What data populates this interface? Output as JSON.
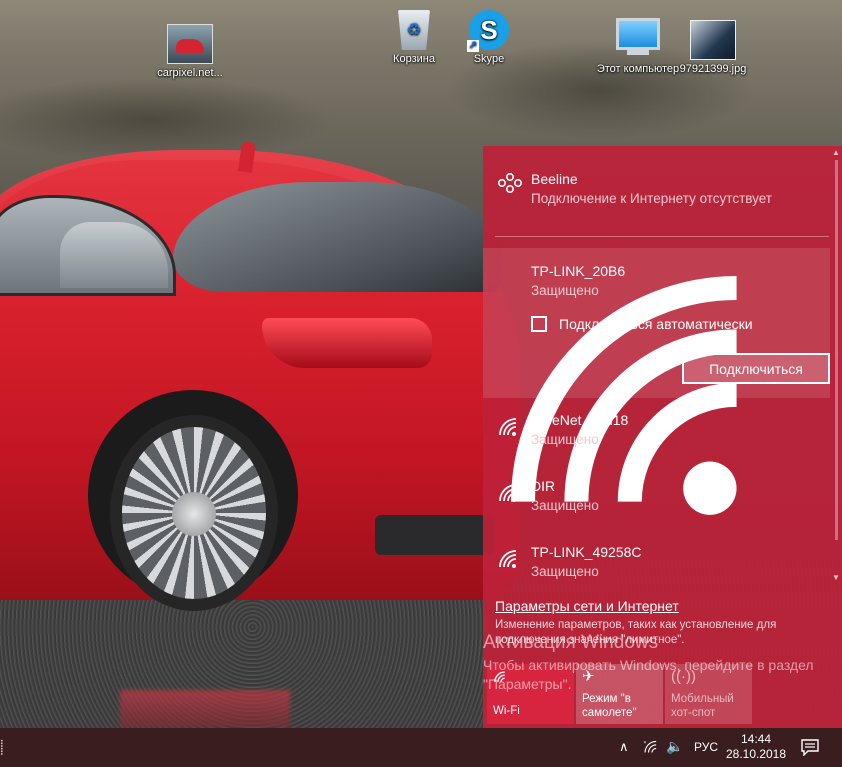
{
  "desktop": {
    "icons": [
      {
        "label": "carpixel.net..."
      },
      {
        "label": "Корзина"
      },
      {
        "label": "Skype"
      },
      {
        "label": "Этот компьютер"
      },
      {
        "label": "97921399.jpg"
      }
    ]
  },
  "flyout": {
    "networks": [
      {
        "name": "Beeline",
        "status": "Подключение к Интернету отсутствует",
        "icon": "wired-network-icon"
      },
      {
        "name": "TP-LINK_20B6",
        "status": "Защищено",
        "icon": "wifi-secured-icon"
      },
      {
        "name": "FreeNet_bud18",
        "status": "Защищено",
        "icon": "wifi-secured-icon"
      },
      {
        "name": "DIR",
        "status": "Защищено",
        "icon": "wifi-secured-icon"
      },
      {
        "name": "TP-LINK_49258C",
        "status": "Защищено",
        "icon": "wifi-secured-icon"
      }
    ],
    "auto_connect_label": "Подключаться автоматически",
    "auto_connect_checked": false,
    "connect_button": "Подключиться",
    "settings_link": "Параметры сети и Интернет",
    "settings_description": "Изменение параметров, таких как установление для подключения значения \"лимитное\".",
    "quick_actions": [
      {
        "label": "Wi-Fi",
        "icon": "wifi-icon",
        "active": true
      },
      {
        "label": "Режим \"в самолете\"",
        "icon": "airplane-icon",
        "active": false
      },
      {
        "label": "Мобильный хот-спот",
        "icon": "hotspot-icon",
        "active": false,
        "disabled": true
      }
    ],
    "accent_color": "#be2139"
  },
  "activation": {
    "title": "Активация Windows",
    "text": "Чтобы активировать Windows, перейдите в раздел \"Параметры\"."
  },
  "taskbar": {
    "language": "РУС",
    "time": "14:44",
    "date": "28.10.2018"
  }
}
